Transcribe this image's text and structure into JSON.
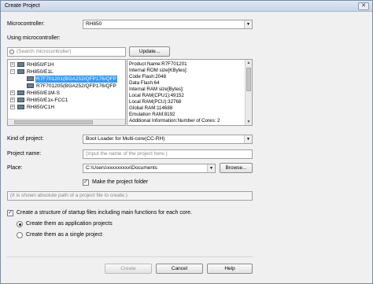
{
  "window": {
    "title": "Create Project",
    "close_glyph": "✕"
  },
  "microcontroller": {
    "label": "Microcontroller:",
    "value": "RH850"
  },
  "using": {
    "label": "Using microcontroller:",
    "search_placeholder": "(Search microcontroller)",
    "update_button": "Update..."
  },
  "tree": [
    {
      "label": "RH850/F1H",
      "expander": "+"
    },
    {
      "label": "RH850/E1L",
      "expander": "−"
    },
    {
      "label": "R7F701201(BGA252/QFP176/QFP",
      "selected": true
    },
    {
      "label": "R7F701205(BGA252/QFP176/QFP"
    },
    {
      "label": "RH850/E1M-S",
      "expander": "+"
    },
    {
      "label": "RH850/E1x-FCC1",
      "expander": "+"
    },
    {
      "label": "RH850/C1H",
      "expander": "+"
    }
  ],
  "info": [
    "Product Name:R7F701201",
    "Internal ROM size[KBytes]:",
    "  Code Flash:2048",
    "  Data Flash:64",
    "Internal RAM size[Bytes]:",
    "  Local RAM(CPU1):49152",
    "  Local RAM(PCU):32768",
    "  Global RAM:114688",
    "  Emulation RAM:8192",
    "Additional Information:Number of Cores: 2"
  ],
  "kind": {
    "label": "Kind of project:",
    "value": "Boot Loader for Multi-core(CC-RH)"
  },
  "project_name": {
    "label": "Project name:",
    "placeholder": "(Input the name of the project here.)"
  },
  "place": {
    "label": "Place:",
    "value": "C:\\Users\\xxxxxxxxx\\Documents",
    "browse_button": "Browse..."
  },
  "make_folder": {
    "label": "Make the project folder",
    "checked": "✓"
  },
  "abs_path": {
    "placeholder": "(It is shown absolute path of a project file to create.)"
  },
  "structure": {
    "label": "Create a structure of startup files including main functions for each core.",
    "checked": "✓",
    "radio_app": "Create them as application projects",
    "radio_single": "Create them as a single project"
  },
  "footer": {
    "create": "Create",
    "cancel": "Cancel",
    "help": "Help"
  },
  "icons": {
    "dropdown": "▼",
    "up": "▲",
    "down": "▼"
  }
}
